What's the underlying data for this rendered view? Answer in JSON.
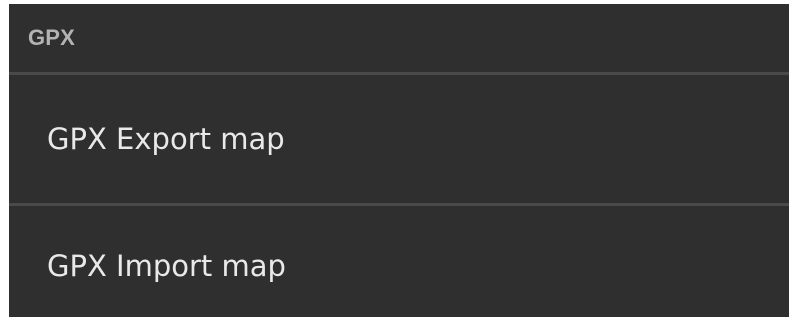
{
  "section": {
    "title": "GPX"
  },
  "menu": {
    "items": [
      {
        "label": "GPX Export map"
      },
      {
        "label": "GPX Import map"
      }
    ]
  },
  "colors": {
    "panel_background": "#2f2f2f",
    "header_text": "#b3b3b3",
    "item_text": "#e9e9e9",
    "divider": "#4a4a4a"
  }
}
